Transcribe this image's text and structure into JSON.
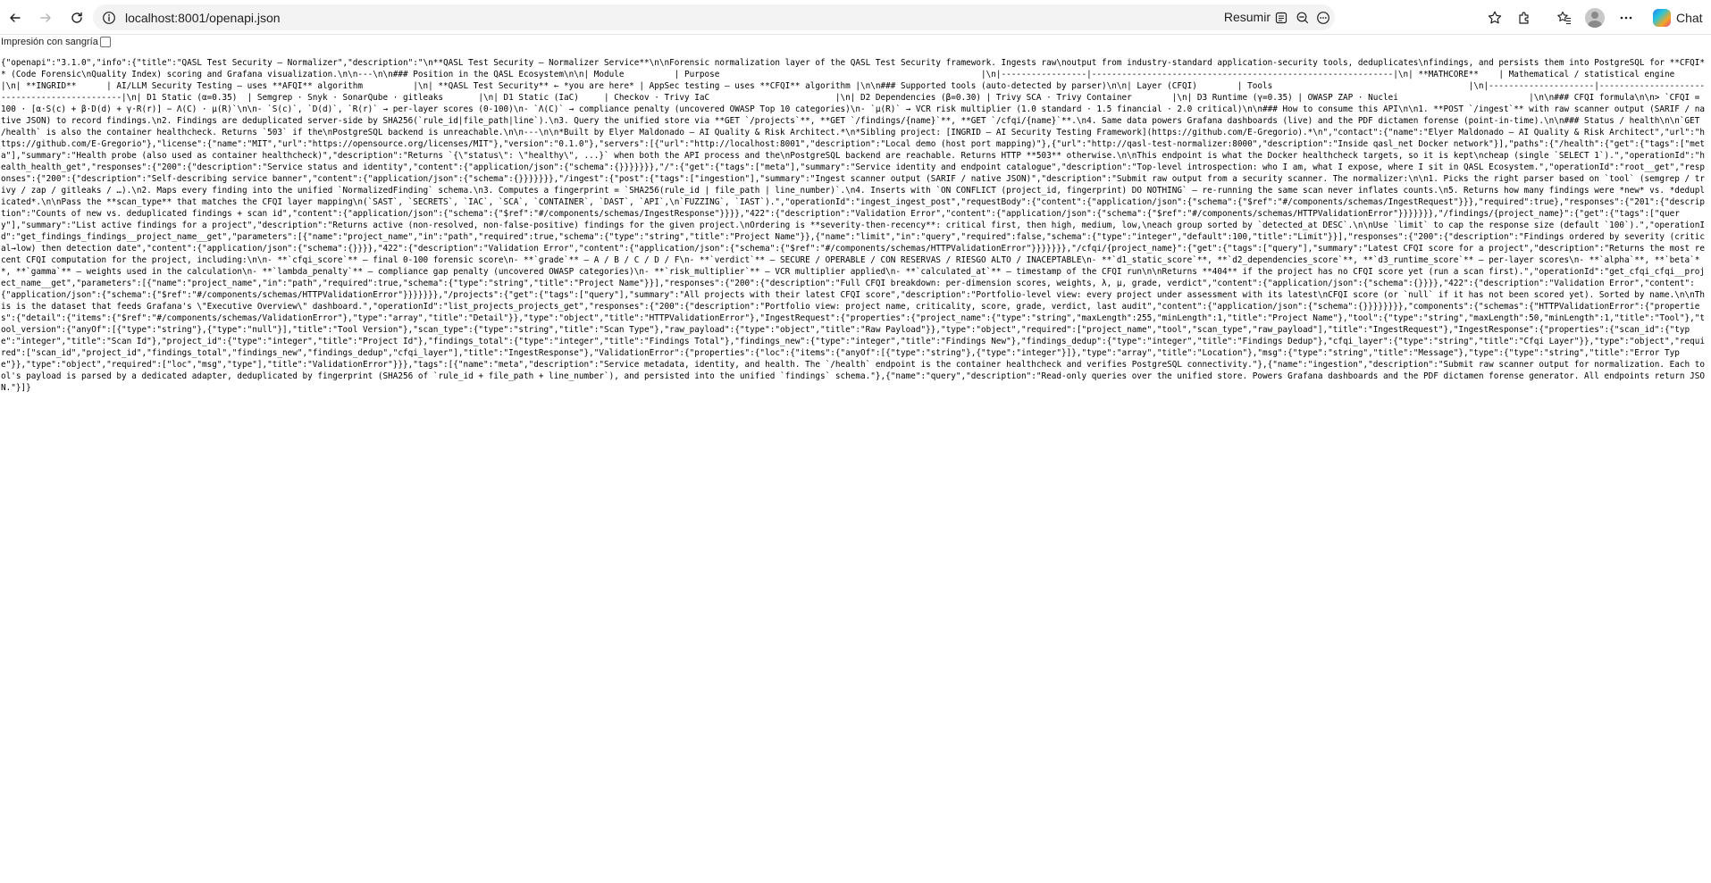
{
  "browser": {
    "url": "localhost:8001/openapi.json",
    "reader_label": "Resumir",
    "chat_label": "Chat",
    "icons": {
      "back": "arrow-left-icon",
      "forward": "arrow-right-icon",
      "reload": "reload-icon",
      "site_info": "info-icon",
      "reader": "reader-icon",
      "zoom_out": "zoom-out-icon",
      "more_in_url": "more-horizontal-icon",
      "favorite": "star-icon",
      "extensions": "puzzle-icon",
      "favorites_bar": "favorites-icon",
      "profile": "avatar",
      "menu": "more-horizontal-icon",
      "copilot": "copilot-icon"
    }
  },
  "viewer": {
    "pretty_print_label": "Impresión con sangría",
    "pretty_print_checked": false
  },
  "json_text": "{\"openapi\":\"3.1.0\",\"info\":{\"title\":\"QASL Test Security — Normalizer\",\"description\":\"\\n**QASL Test Security — Normalizer Service**\\n\\nForensic normalization layer of the QASL Test Security framework. Ingests raw\\noutput from industry-standard application-security tools, deduplicates\\nfindings, and persists them into PostgreSQL for **CFQI** (Code Forensic\\nQuality Index) scoring and Grafana visualization.\\n\\n---\\n\\n### Position in the QASL Ecosystem\\n\\n| Module          | Purpose                                                    |\\n|-----------------|------------------------------------------------------------|\\n| **MATHCORE**    | Mathematical / statistical engine                          |\\n| **INGRID**      | AI/LLM Security Testing — uses **AFQI** algorithm          |\\n| **QASL Test Security** ← *you are here* | AppSec testing — uses **CFQI** algorithm |\\n\\n### Supported tools (auto-detected by parser)\\n\\n| Layer (CFQI)        | Tools                                       |\\n|---------------------|---------------------------------------------|\\n| D1 Static (α=0.35)  | Semgrep · Snyk · SonarQube · gitleaks       |\\n| D1 Static (IaC)     | Checkov · Trivy IaC                         |\\n| D2 Dependencies (β=0.30) | Trivy SCA · Trivy Container        |\\n| D3 Runtime (γ=0.35) | OWASP ZAP · Nuclei                          |\\n\\n### CFQI formula\\n\\n> `CFQI = 100 · [α·S(c) + β·D(d) + γ·R(r)] − Λ(C) · μ(R)`\\n\\n- `S(c)`, `D(d)`, `R(r)` → per-layer scores (0-100)\\n- `Λ(C)` → compliance penalty (uncovered OWASP Top 10 categories)\\n- `μ(R)` → VCR risk multiplier (1.0 standard · 1.5 financial · 2.0 critical)\\n\\n### How to consume this API\\n\\n1. **POST `/ingest`** with raw scanner output (SARIF / native JSON) to record findings.\\n2. Findings are deduplicated server-side by SHA256(`rule_id|file_path|line`).\\n3. Query the unified store via **GET `/projects`**, **GET `/findings/{name}`**, **GET `/cfqi/{name}`**.\\n4. Same data powers Grafana dashboards (live) and the PDF dictamen forense (point-in-time).\\n\\n### Status / health\\n\\n`GET /health` is also the container healthcheck. Returns `503` if the\\nPostgreSQL backend is unreachable.\\n\\n---\\n\\n*Built by Elyer Maldonado — AI Quality & Risk Architect.*\\n*Sibling project: [INGRID — AI Security Testing Framework](https://github.com/E-Gregorio).*\\n\",\"contact\":{\"name\":\"Elyer Maldonado — AI Quality & Risk Architect\",\"url\":\"https://github.com/E-Gregorio\"},\"license\":{\"name\":\"MIT\",\"url\":\"https://opensource.org/licenses/MIT\"},\"version\":\"0.1.0\"},\"servers\":[{\"url\":\"http://localhost:8001\",\"description\":\"Local demo (host port mapping)\"},{\"url\":\"http://qasl-test-normalizer:8000\",\"description\":\"Inside qasl_net Docker network\"}],\"paths\":{\"/health\":{\"get\":{\"tags\":[\"meta\"],\"summary\":\"Health probe (also used as container healthcheck)\",\"description\":\"Returns `{\\\"status\\\": \\\"healthy\\\", ...}` when both the API process and the\\nPostgreSQL backend are reachable. Returns HTTP **503** otherwise.\\n\\nThis endpoint is what the Docker healthcheck targets, so it is kept\\ncheap (single `SELECT 1`).\",\"operationId\":\"health_health_get\",\"responses\":{\"200\":{\"description\":\"Service status and identity\",\"content\":{\"application/json\":{\"schema\":{}}}}}}},\"/\":{\"get\":{\"tags\":[\"meta\"],\"summary\":\"Service identity and endpoint catalogue\",\"description\":\"Top-level introspection: who I am, what I expose, where I sit in QASL Ecosystem.\",\"operationId\":\"root__get\",\"responses\":{\"200\":{\"description\":\"Self-describing service banner\",\"content\":{\"application/json\":{\"schema\":{}}}}}}},\"/ingest\":{\"post\":{\"tags\":[\"ingestion\"],\"summary\":\"Ingest scanner output (SARIF / native JSON)\",\"description\":\"Submit raw output from a security scanner. The normalizer:\\n\\n1. Picks the right parser based on `tool` (semgrep / trivy / zap / gitleaks / …).\\n2. Maps every finding into the unified `NormalizedFinding` schema.\\n3. Computes a fingerprint = `SHA256(rule_id | file_path | line_number)`.\\n4. Inserts with `ON CONFLICT (project_id, fingerprint) DO NOTHING` — re-running the same scan never inflates counts.\\n5. Returns how many findings were *new* vs. *deduplicated*.\\n\\nPass the **scan_type** that matches the CFQI layer mapping\\n(`SAST`, `SECRETS`, `IAC`, `SCA`, `CONTAINER`, `DAST`, `API`,\\n`FUZZING`, `IAST`).\",\"operationId\":\"ingest_ingest_post\",\"requestBody\":{\"content\":{\"application/json\":{\"schema\":{\"$ref\":\"#/components/schemas/IngestRequest\"}}},\"required\":true},\"responses\":{\"201\":{\"description\":\"Counts of new vs. deduplicated findings + scan id\",\"content\":{\"application/json\":{\"schema\":{\"$ref\":\"#/components/schemas/IngestResponse\"}}}},\"422\":{\"description\":\"Validation Error\",\"content\":{\"application/json\":{\"schema\":{\"$ref\":\"#/components/schemas/HTTPValidationError\"}}}}}}},\"/findings/{project_name}\":{\"get\":{\"tags\":[\"query\"],\"summary\":\"List active findings for a project\",\"description\":\"Returns active (non-resolved, non-false-positive) findings for the given project.\\nOrdering is **severity-then-recency**: critical first, then high, medium, low,\\neach group sorted by `detected_at DESC`.\\n\\nUse `limit` to cap the response size (default `100`).\",\"operationId\":\"get_findings_findings__project_name__get\",\"parameters\":[{\"name\":\"project_name\",\"in\":\"path\",\"required\":true,\"schema\":{\"type\":\"string\",\"title\":\"Project Name\"}},{\"name\":\"limit\",\"in\":\"query\",\"required\":false,\"schema\":{\"type\":\"integer\",\"default\":100,\"title\":\"Limit\"}}],\"responses\":{\"200\":{\"description\":\"Findings ordered by severity (critical→low) then detection date\",\"content\":{\"application/json\":{\"schema\":{}}}},\"422\":{\"description\":\"Validation Error\",\"content\":{\"application/json\":{\"schema\":{\"$ref\":\"#/components/schemas/HTTPValidationError\"}}}}}}},\"/cfqi/{project_name}\":{\"get\":{\"tags\":[\"query\"],\"summary\":\"Latest CFQI score for a project\",\"description\":\"Returns the most recent CFQI computation for the project, including:\\n\\n- **`cfqi_score`** — final 0-100 forensic score\\n- **`grade`** — A / B / C / D / F\\n- **`verdict`** — SECURE / OPERABLE / CON RESERVAS / RIESGO ALTO / INACEPTABLE\\n- **`d1_static_score`**, **`d2_dependencies_score`**, **`d3_runtime_score`** — per-layer scores\\n- **`alpha`**, **`beta`**, **`gamma`** — weights used in the calculation\\n- **`lambda_penalty`** — compliance gap penalty (uncovered OWASP categories)\\n- **`risk_multiplier`** — VCR multiplier applied\\n- **`calculated_at`** — timestamp of the CFQI run\\n\\nReturns **404** if the project has no CFQI score yet (run a scan first).\",\"operationId\":\"get_cfqi_cfqi__project_name__get\",\"parameters\":[{\"name\":\"project_name\",\"in\":\"path\",\"required\":true,\"schema\":{\"type\":\"string\",\"title\":\"Project Name\"}}],\"responses\":{\"200\":{\"description\":\"Full CFQI breakdown: per-dimension scores, weights, λ, μ, grade, verdict\",\"content\":{\"application/json\":{\"schema\":{}}}},\"422\":{\"description\":\"Validation Error\",\"content\":{\"application/json\":{\"schema\":{\"$ref\":\"#/components/schemas/HTTPValidationError\"}}}}}}},\"/projects\":{\"get\":{\"tags\":[\"query\"],\"summary\":\"All projects with their latest CFQI score\",\"description\":\"Portfolio-level view: every project under assessment with its latest\\nCFQI score (or `null` if it has not been scored yet). Sorted by name.\\n\\nThis is the dataset that feeds Grafana's \\\"Executive Overview\\\" dashboard.\",\"operationId\":\"list_projects_projects_get\",\"responses\":{\"200\":{\"description\":\"Portfolio view: project name, criticality, score, grade, verdict, last audit\",\"content\":{\"application/json\":{\"schema\":{}}}}}}}},\"components\":{\"schemas\":{\"HTTPValidationError\":{\"properties\":{\"detail\":{\"items\":{\"$ref\":\"#/components/schemas/ValidationError\"},\"type\":\"array\",\"title\":\"Detail\"}},\"type\":\"object\",\"title\":\"HTTPValidationError\"},\"IngestRequest\":{\"properties\":{\"project_name\":{\"type\":\"string\",\"maxLength\":255,\"minLength\":1,\"title\":\"Project Name\"},\"tool\":{\"type\":\"string\",\"maxLength\":50,\"minLength\":1,\"title\":\"Tool\"},\"tool_version\":{\"anyOf\":[{\"type\":\"string\"},{\"type\":\"null\"}],\"title\":\"Tool Version\"},\"scan_type\":{\"type\":\"string\",\"title\":\"Scan Type\"},\"raw_payload\":{\"type\":\"object\",\"title\":\"Raw Payload\"}},\"type\":\"object\",\"required\":[\"project_name\",\"tool\",\"scan_type\",\"raw_payload\"],\"title\":\"IngestRequest\"},\"IngestResponse\":{\"properties\":{\"scan_id\":{\"type\":\"integer\",\"title\":\"Scan Id\"},\"project_id\":{\"type\":\"integer\",\"title\":\"Project Id\"},\"findings_total\":{\"type\":\"integer\",\"title\":\"Findings Total\"},\"findings_new\":{\"type\":\"integer\",\"title\":\"Findings New\"},\"findings_dedup\":{\"type\":\"integer\",\"title\":\"Findings Dedup\"},\"cfqi_layer\":{\"type\":\"string\",\"title\":\"Cfqi Layer\"}},\"type\":\"object\",\"required\":[\"scan_id\",\"project_id\",\"findings_total\",\"findings_new\",\"findings_dedup\",\"cfqi_layer\"],\"title\":\"IngestResponse\"},\"ValidationError\":{\"properties\":{\"loc\":{\"items\":{\"anyOf\":[{\"type\":\"string\"},{\"type\":\"integer\"}]},\"type\":\"array\",\"title\":\"Location\"},\"msg\":{\"type\":\"string\",\"title\":\"Message\"},\"type\":{\"type\":\"string\",\"title\":\"Error Type\"}},\"type\":\"object\",\"required\":[\"loc\",\"msg\",\"type\"],\"title\":\"ValidationError\"}}},\"tags\":[{\"name\":\"meta\",\"description\":\"Service metadata, identity, and health. The `/health` endpoint is the container healthcheck and verifies PostgreSQL connectivity.\"},{\"name\":\"ingestion\",\"description\":\"Submit raw scanner output for normalization. Each tool's payload is parsed by a dedicated adapter, deduplicated by fingerprint (SHA256 of `rule_id + file_path + line_number`), and persisted into the unified `findings` schema.\"},{\"name\":\"query\",\"description\":\"Read-only queries over the unified store. Powers Grafana dashboards and the PDF dictamen forense generator. All endpoints return JSON.\"}]}"
}
